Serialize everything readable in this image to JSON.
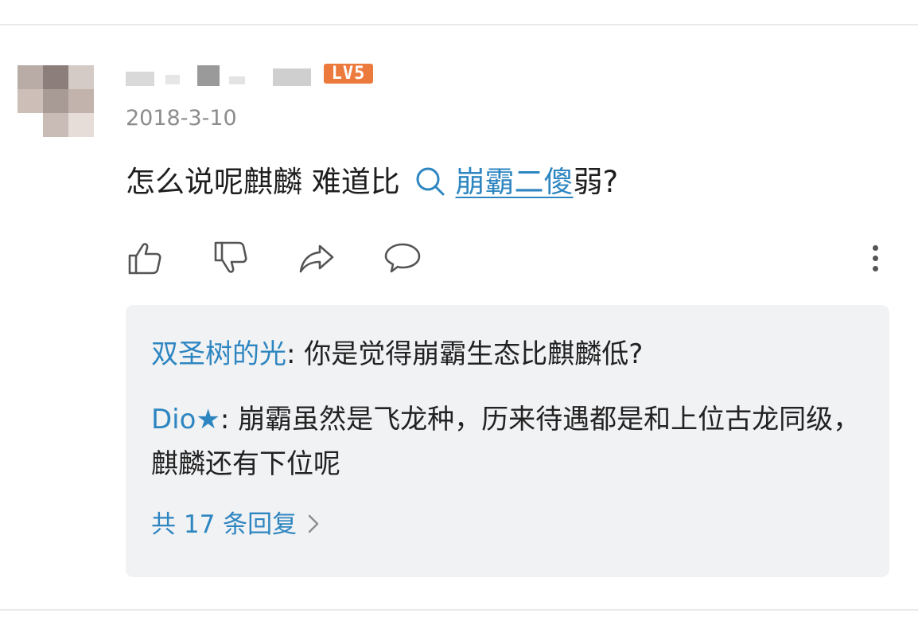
{
  "post": {
    "level_badge": "LV5",
    "date": "2018-3-10",
    "text_before": "怎么说呢麒麟 难道比",
    "topic_link": "崩霸二傻",
    "text_after": "弱?"
  },
  "actions": {
    "like_icon": "thumbs-up-icon",
    "dislike_icon": "thumbs-down-icon",
    "share_icon": "share-icon",
    "comment_icon": "comment-icon",
    "more_icon": "more-vertical-icon"
  },
  "replies": [
    {
      "author": "双圣树的光",
      "separator": ": ",
      "text": "你是觉得崩霸生态比麒麟低?"
    },
    {
      "author": "Dio★",
      "separator": ": ",
      "text": "崩霸虽然是飞龙种，历来待遇都是和上位古龙同级，麒麟还有下位呢"
    }
  ],
  "more_replies_label": "共 17 条回复",
  "colors": {
    "link": "#2e86c1",
    "badge": "#ec7a3c",
    "reply_background": "#f1f2f4",
    "date": "#8c8c8c"
  }
}
